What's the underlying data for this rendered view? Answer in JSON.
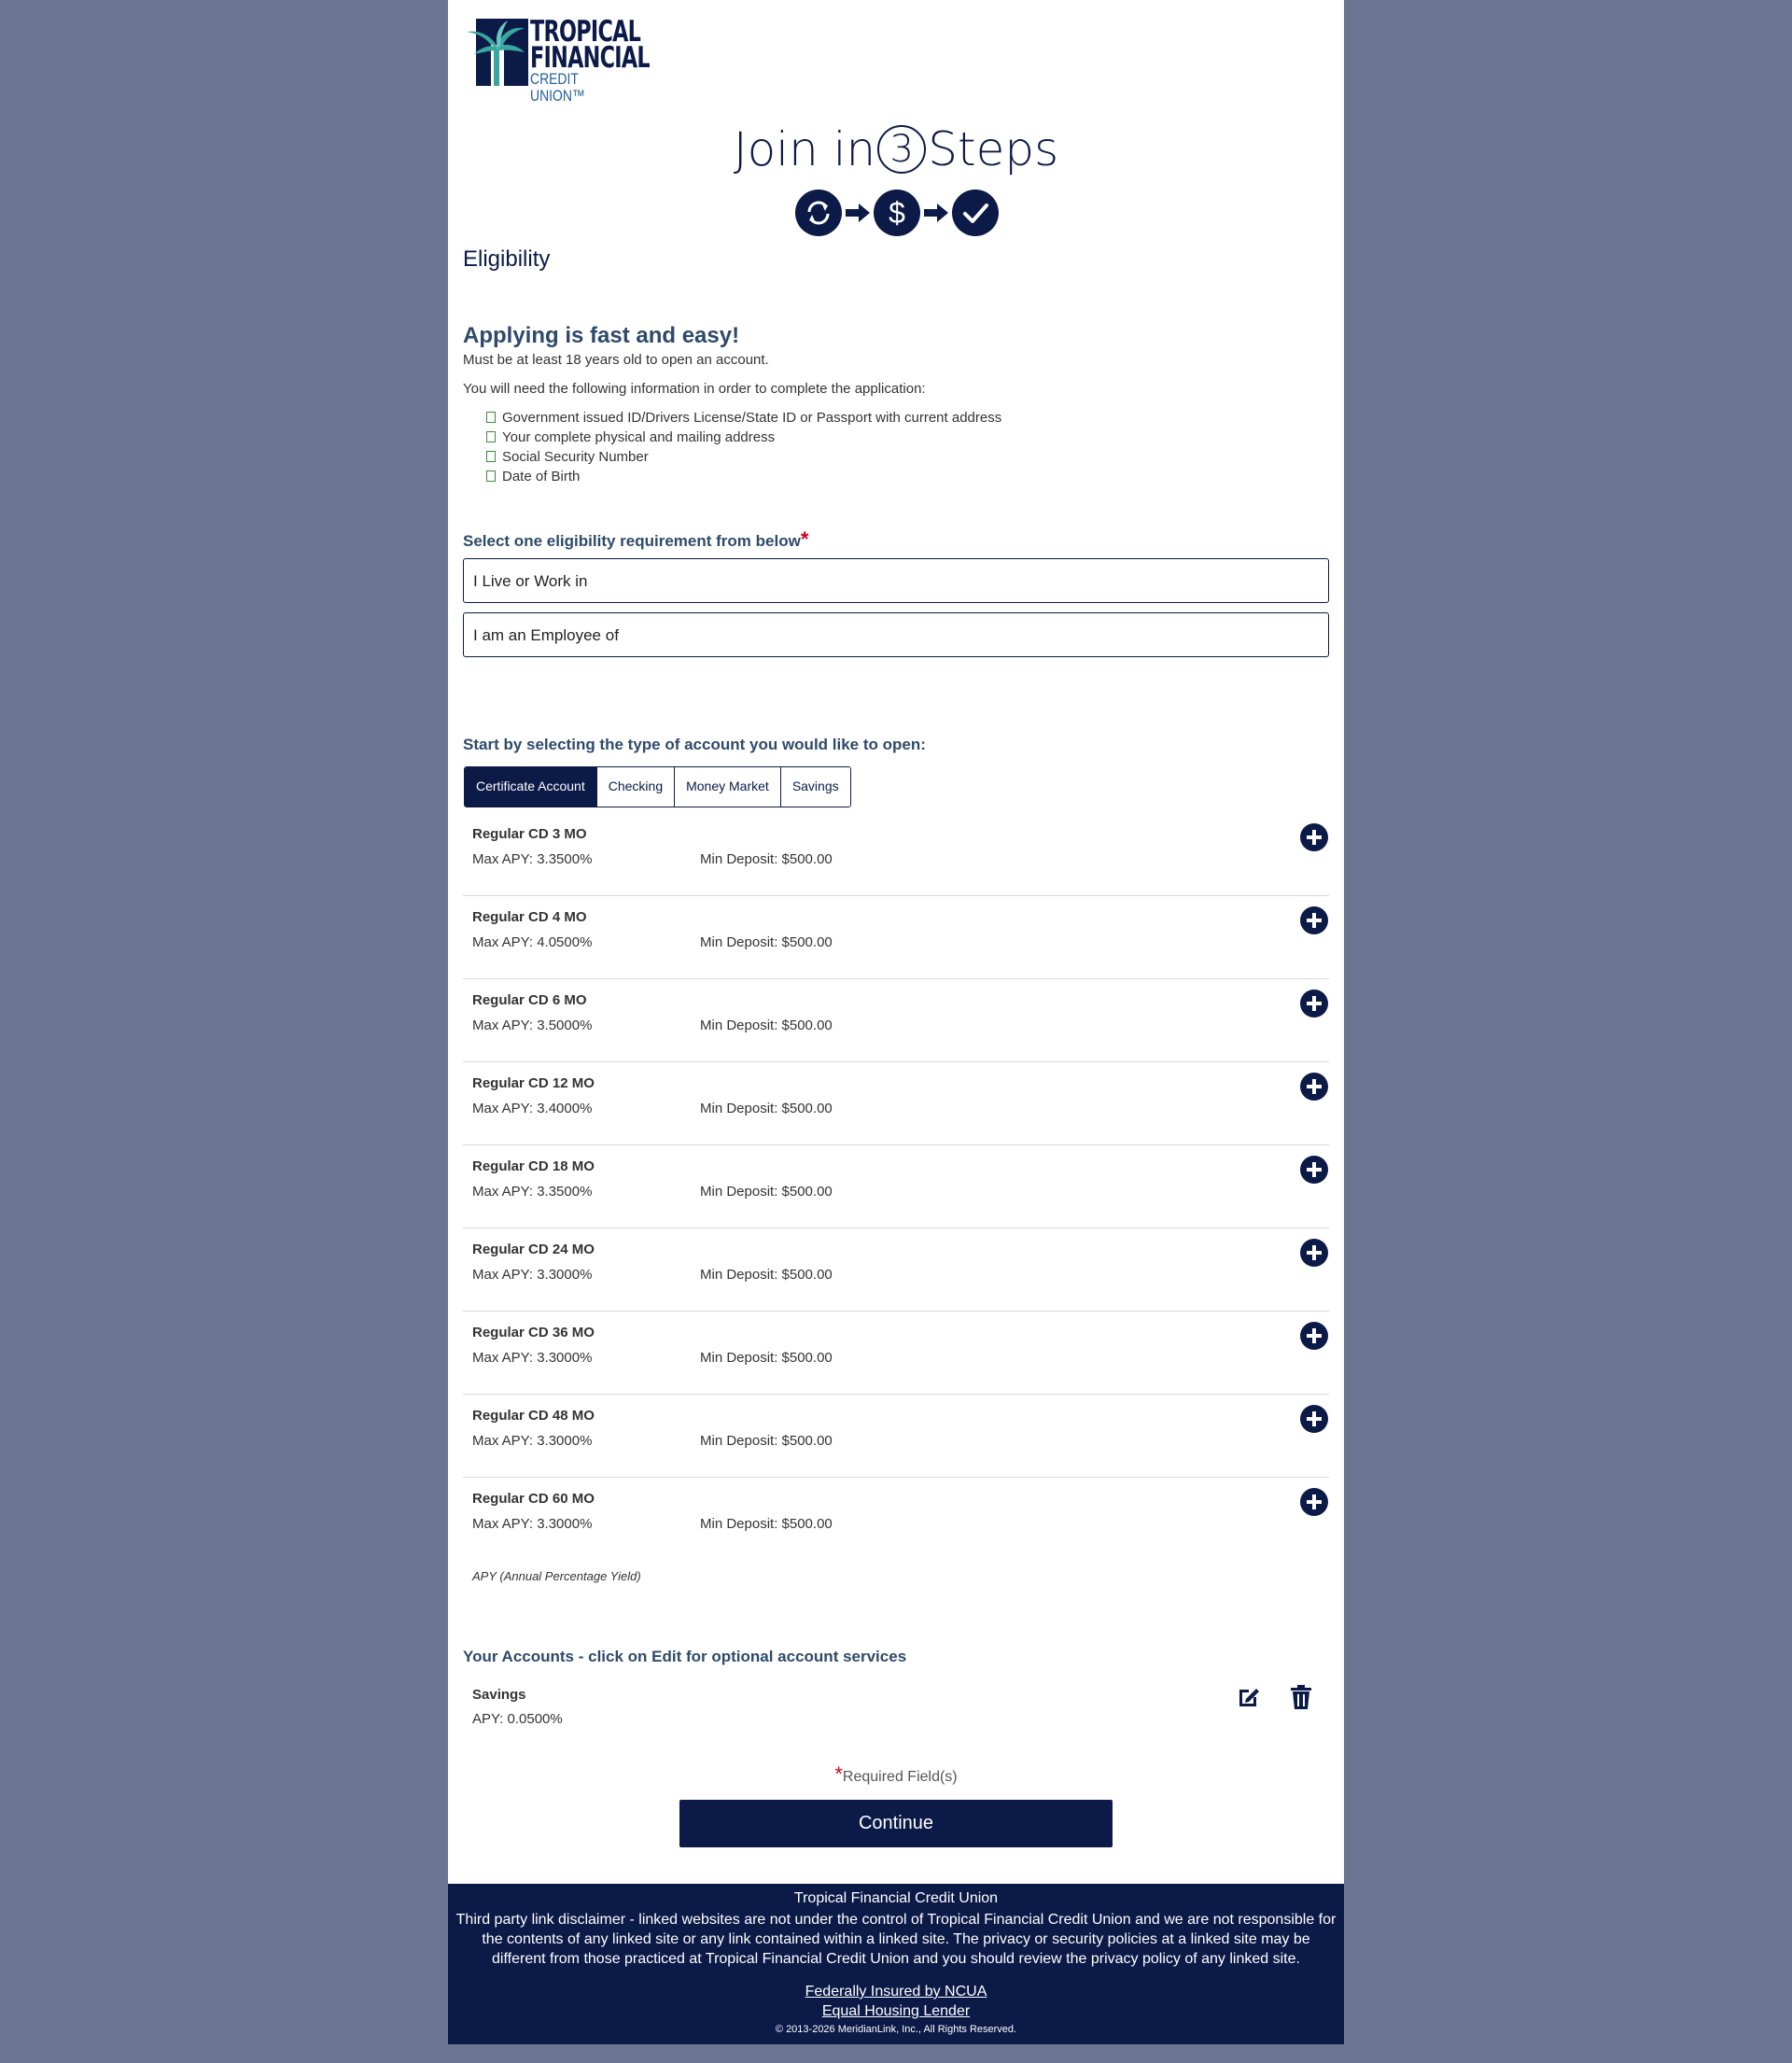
{
  "logo": {
    "line1": "TROPICAL",
    "line2": "FINANCIAL",
    "line3": "CREDIT UNION™",
    "alt": "Tropical Financial Credit Union"
  },
  "join": {
    "before": "Join in",
    "number": "3",
    "after": "Steps"
  },
  "step_icons": [
    "refresh-icon",
    "dollar-icon",
    "check-icon"
  ],
  "eligibility": {
    "heading": "Eligibility",
    "fast_heading": "Applying is fast and easy!",
    "age_note": "Must be at least 18 years old to open an account.",
    "info_intro": "You will need the following information in order to complete the application:",
    "requirements": [
      "Government issued ID/Drivers License/State ID or Passport with current address",
      "Your complete physical and mailing address",
      "Social Security Number",
      "Date of Birth"
    ],
    "select_label": "Select one eligibility requirement from below",
    "required_star": "*",
    "options": [
      "I Live or Work in",
      "I am an Employee of"
    ]
  },
  "accounts": {
    "select_label": "Start by selecting the type of account you would like to open:",
    "tabs": [
      "Certificate Account",
      "Checking",
      "Money Market",
      "Savings"
    ],
    "active_tab": "Certificate Account",
    "products": [
      {
        "name": "Regular CD 3 MO",
        "apy": "Max APY: 3.3500%",
        "min_deposit": "Min Deposit: $500.00"
      },
      {
        "name": "Regular CD 4 MO",
        "apy": "Max APY: 4.0500%",
        "min_deposit": "Min Deposit: $500.00"
      },
      {
        "name": "Regular CD 6 MO",
        "apy": "Max APY: 3.5000%",
        "min_deposit": "Min Deposit: $500.00"
      },
      {
        "name": "Regular CD 12 MO",
        "apy": "Max APY: 3.4000%",
        "min_deposit": "Min Deposit: $500.00"
      },
      {
        "name": "Regular CD 18 MO",
        "apy": "Max APY: 3.3500%",
        "min_deposit": "Min Deposit: $500.00"
      },
      {
        "name": "Regular CD 24 MO",
        "apy": "Max APY: 3.3000%",
        "min_deposit": "Min Deposit: $500.00"
      },
      {
        "name": "Regular CD 36 MO",
        "apy": "Max APY: 3.3000%",
        "min_deposit": "Min Deposit: $500.00"
      },
      {
        "name": "Regular CD 48 MO",
        "apy": "Max APY: 3.3000%",
        "min_deposit": "Min Deposit: $500.00"
      },
      {
        "name": "Regular CD 60 MO",
        "apy": "Max APY: 3.3000%",
        "min_deposit": "Min Deposit: $500.00"
      }
    ],
    "apy_note": "APY (Annual Percentage Yield)"
  },
  "your_accounts": {
    "heading": "Your Accounts - click on Edit for optional account services",
    "items": [
      {
        "name": "Savings",
        "apy": "APY: 0.0500%"
      }
    ]
  },
  "form": {
    "required_star": "*",
    "required_note": "Required Field(s)",
    "continue_label": "Continue"
  },
  "footer": {
    "name": "Tropical Financial Credit Union",
    "disclaimer": "Third party link disclaimer - linked websites are not under the control of Tropical Financial Credit Union and we are not responsible for the contents of any linked site or any link contained within a linked site. The privacy or security policies at a linked site may be different from those practiced at Tropical Financial Credit Union and you should review the privacy policy of any linked site.",
    "links": [
      "Federally Insured by NCUA",
      "Equal Housing Lender"
    ],
    "copyright": "© 2013-2026 MeridianLink, Inc., All Rights Reserved."
  },
  "colors": {
    "navy": "#0c1a48",
    "page_background": "#6b7591",
    "heading_blue": "#2e4a6b",
    "required_red": "#d0021b",
    "logo_teal": "#3aa6a0"
  }
}
